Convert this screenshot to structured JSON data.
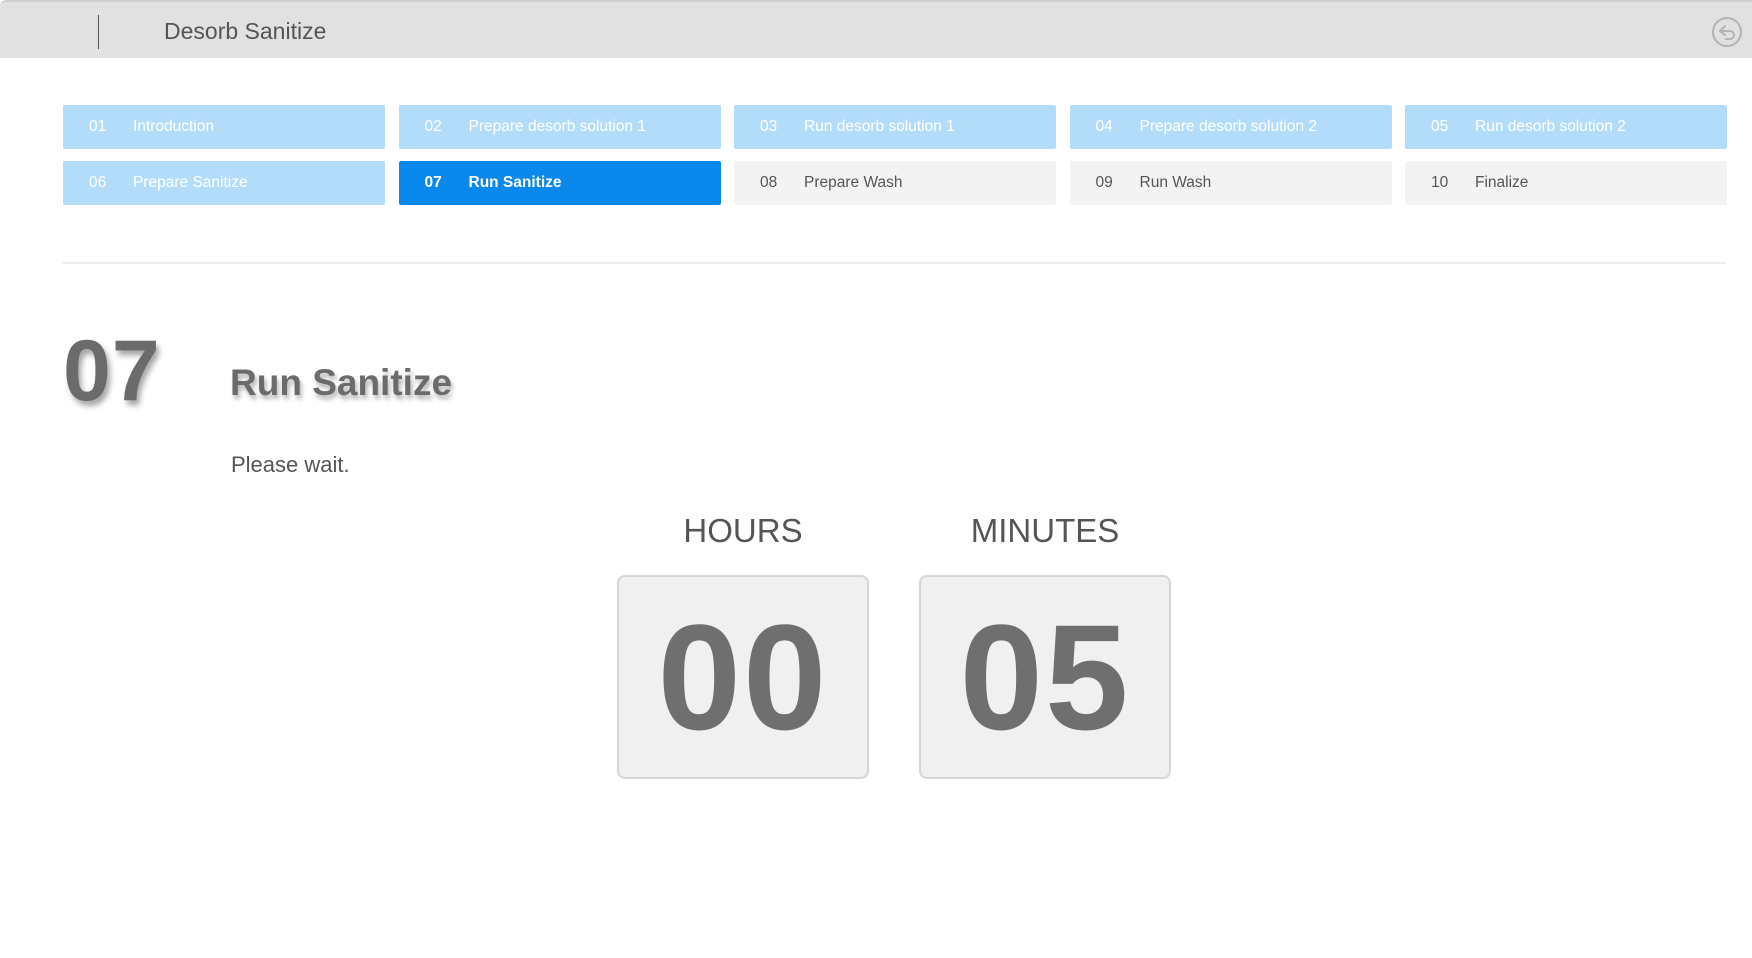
{
  "window": {
    "title": "Desorb Sanitize"
  },
  "steps": [
    {
      "num": "01",
      "label": "Introduction",
      "state": "done"
    },
    {
      "num": "02",
      "label": "Prepare desorb solution 1",
      "state": "done"
    },
    {
      "num": "03",
      "label": "Run desorb solution 1",
      "state": "done"
    },
    {
      "num": "04",
      "label": "Prepare desorb solution 2",
      "state": "done"
    },
    {
      "num": "05",
      "label": "Run desorb solution 2",
      "state": "done"
    },
    {
      "num": "06",
      "label": "Prepare Sanitize",
      "state": "done"
    },
    {
      "num": "07",
      "label": "Run Sanitize",
      "state": "current"
    },
    {
      "num": "08",
      "label": "Prepare Wash",
      "state": "todo"
    },
    {
      "num": "09",
      "label": "Run Wash",
      "state": "todo"
    },
    {
      "num": "10",
      "label": "Finalize",
      "state": "todo"
    }
  ],
  "current_step": {
    "num": "07",
    "title": "Run Sanitize",
    "message": "Please wait."
  },
  "timer": {
    "hours_label": "HOURS",
    "minutes_label": "MINUTES",
    "hours": "00",
    "minutes": "05"
  },
  "colors": {
    "done": "#b3dcfb",
    "current": "#0a88ec",
    "todo": "#f3f3f3"
  },
  "icons": {
    "back": "back-arrow-icon"
  }
}
